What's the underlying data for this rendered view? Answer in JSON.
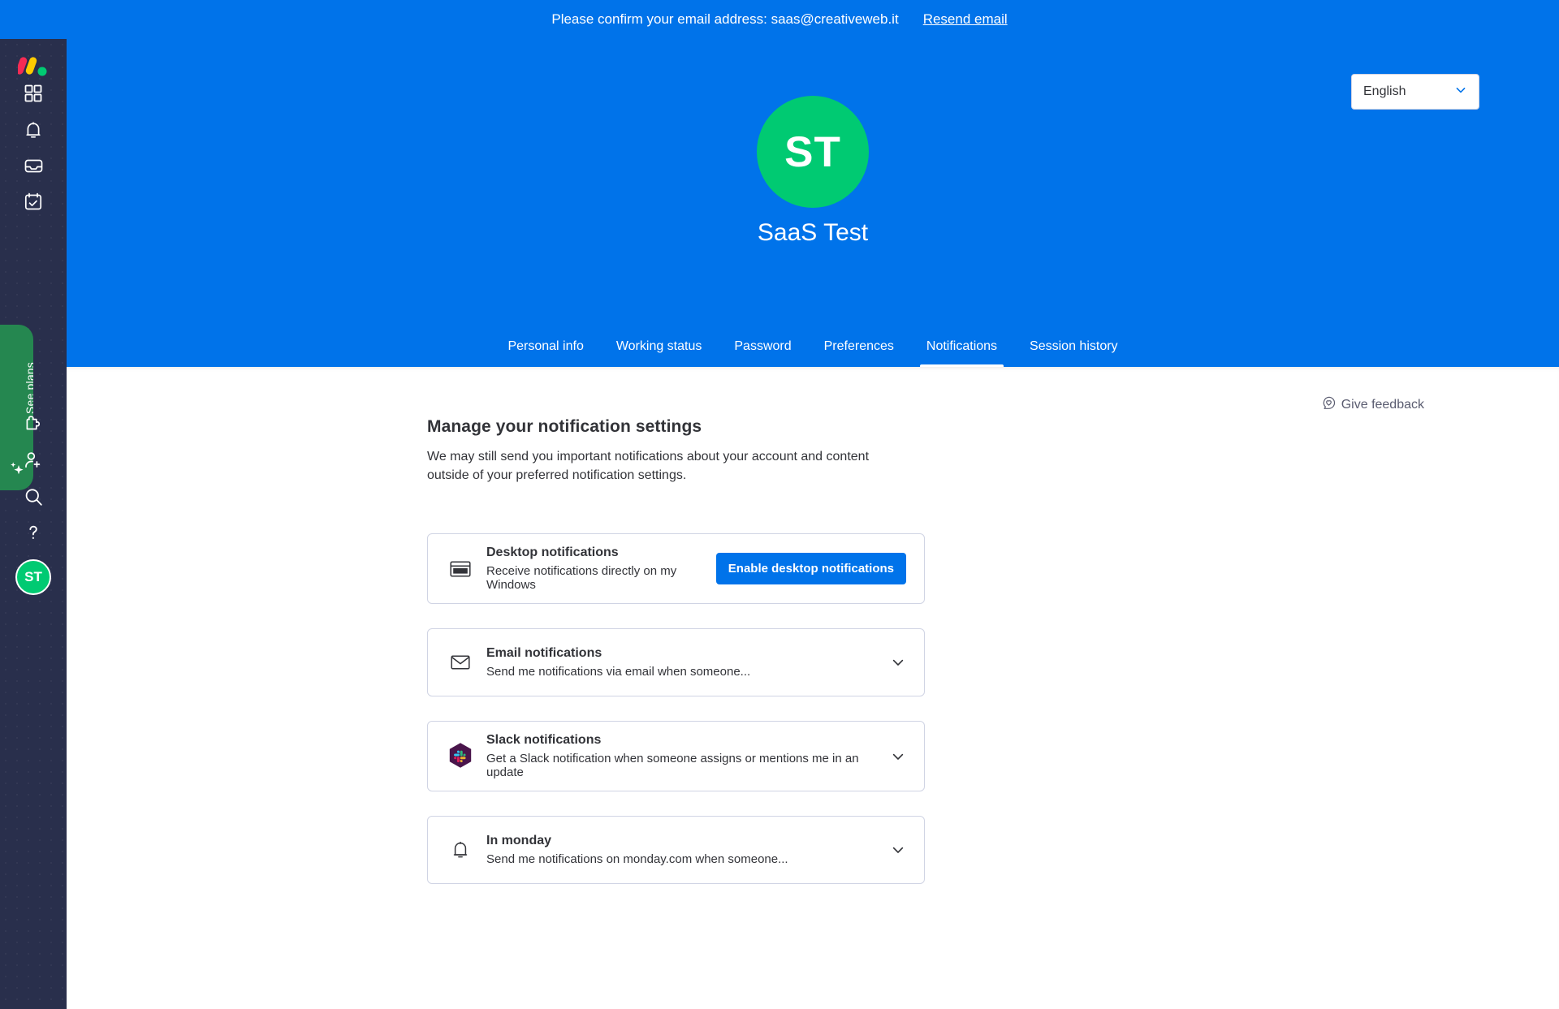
{
  "banner": {
    "message": "Please confirm your email address: saas@creativeweb.it",
    "resend_label": "Resend email"
  },
  "sidebar": {
    "logo_name": "monday-logo",
    "items": [
      {
        "icon": "grid-apps-icon",
        "label": "Home"
      },
      {
        "icon": "bell-icon",
        "label": "Notifications"
      },
      {
        "icon": "inbox-icon",
        "label": "Inbox"
      },
      {
        "icon": "calendar-check-icon",
        "label": "My work"
      },
      {
        "icon": "puzzle-icon",
        "label": "Apps"
      },
      {
        "icon": "add-user-icon",
        "label": "Invite members"
      },
      {
        "icon": "search-icon",
        "label": "Search"
      },
      {
        "icon": "help-question-icon",
        "label": "Help"
      }
    ],
    "see_plans_label": "See plans",
    "avatar_initials": "ST"
  },
  "header": {
    "language_value": "English",
    "avatar_initials": "ST",
    "profile_name": "SaaS Test",
    "tabs": [
      {
        "label": "Personal info",
        "active": false
      },
      {
        "label": "Working status",
        "active": false
      },
      {
        "label": "Password",
        "active": false
      },
      {
        "label": "Preferences",
        "active": false
      },
      {
        "label": "Notifications",
        "active": true
      },
      {
        "label": "Session history",
        "active": false
      }
    ]
  },
  "main": {
    "give_feedback_label": "Give feedback",
    "title": "Manage your notification settings",
    "subtitle": "We may still send you important notifications about your account and content outside of your preferred notification settings.",
    "cards": [
      {
        "icon": "desktop-window-icon",
        "title": "Desktop notifications",
        "description": "Receive notifications directly on my Windows",
        "action_label": "Enable desktop notifications",
        "has_chevron": false
      },
      {
        "icon": "envelope-icon",
        "title": "Email notifications",
        "description": "Send me notifications via email when someone...",
        "action_label": "",
        "has_chevron": true
      },
      {
        "icon": "slack-icon",
        "title": "Slack notifications",
        "description": "Get a Slack notification when someone assigns or mentions me in an update",
        "action_label": "",
        "has_chevron": true
      },
      {
        "icon": "bell-icon",
        "title": "In monday",
        "description": "Send me notifications on monday.com when someone...",
        "action_label": "",
        "has_chevron": true
      }
    ]
  },
  "colors": {
    "brand_blue": "#0073ea",
    "sidebar_dark": "#292f4c",
    "green_accent": "#00ca72",
    "plans_green": "#258750",
    "text_primary": "#323338"
  }
}
